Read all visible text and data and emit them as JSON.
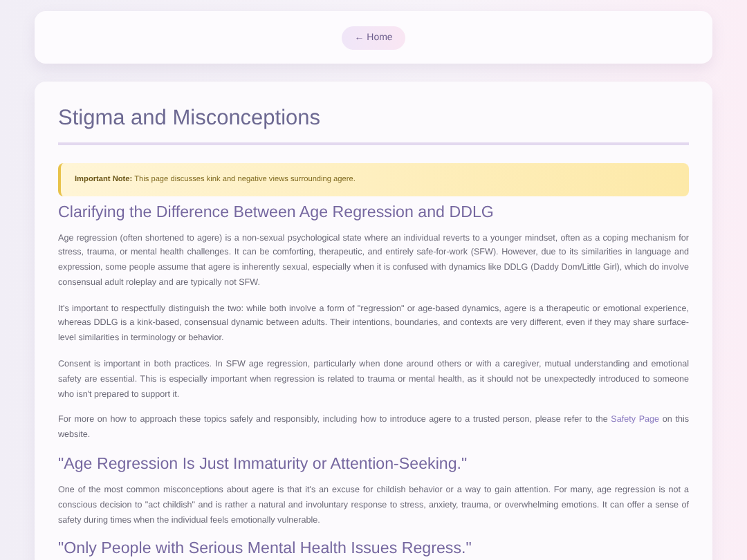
{
  "nav": {
    "home_button": "← Home"
  },
  "title": "Stigma and Misconceptions",
  "note": {
    "label": "Important Note:",
    "text": "This page discusses kink and negative views surrounding agere."
  },
  "sections": [
    {
      "heading": "Clarifying the Difference Between Age Regression and DDLG",
      "paragraphs": [
        {
          "text": "Age regression (often shortened to agere) is a non-sexual psychological state where an individual reverts to a younger mindset, often as a coping mechanism for stress, trauma, or mental health challenges. It can be comforting, therapeutic, and entirely safe-for-work (SFW). However, due to its similarities in language and expression, some people assume that agere is inherently sexual, especially when it is confused with dynamics like DDLG (Daddy Dom/Little Girl), which do involve consensual adult roleplay and are typically not SFW."
        },
        {
          "text": "It's important to respectfully distinguish the two: while both involve a form of \"regression\" or age-based dynamics, agere is a therapeutic or emotional experience, whereas DDLG is a kink-based, consensual dynamic between adults. Their intentions, boundaries, and contexts are very different, even if they may share surface-level similarities in terminology or behavior."
        },
        {
          "text": "Consent is important in both practices. In SFW age regression, particularly when done around others or with a caregiver, mutual understanding and emotional safety are essential. This is especially important when regression is related to trauma or mental health, as it should not be unexpectedly introduced to someone who isn't prepared to support it."
        },
        {
          "text": "For more on how to approach these topics safely and responsibly, including how to introduce agere to a trusted person, please refer to the",
          "link": "Safety Page",
          "after": "on this website."
        }
      ]
    },
    {
      "heading": "\"Age Regression Is Just Immaturity or Attention-Seeking.\"",
      "paragraphs": [
        {
          "text": "One of the most common misconceptions about agere is that it's an excuse for childish behavior or a way to gain attention. For many, age regression is not a conscious decision to \"act childish\" and is rather a natural and involuntary response to stress, anxiety, trauma, or overwhelming emotions. It can offer a sense of safety during times when the individual feels emotionally vulnerable."
        }
      ]
    },
    {
      "heading": "\"Only People with Serious Mental Health Issues Regress.\""
    }
  ]
}
